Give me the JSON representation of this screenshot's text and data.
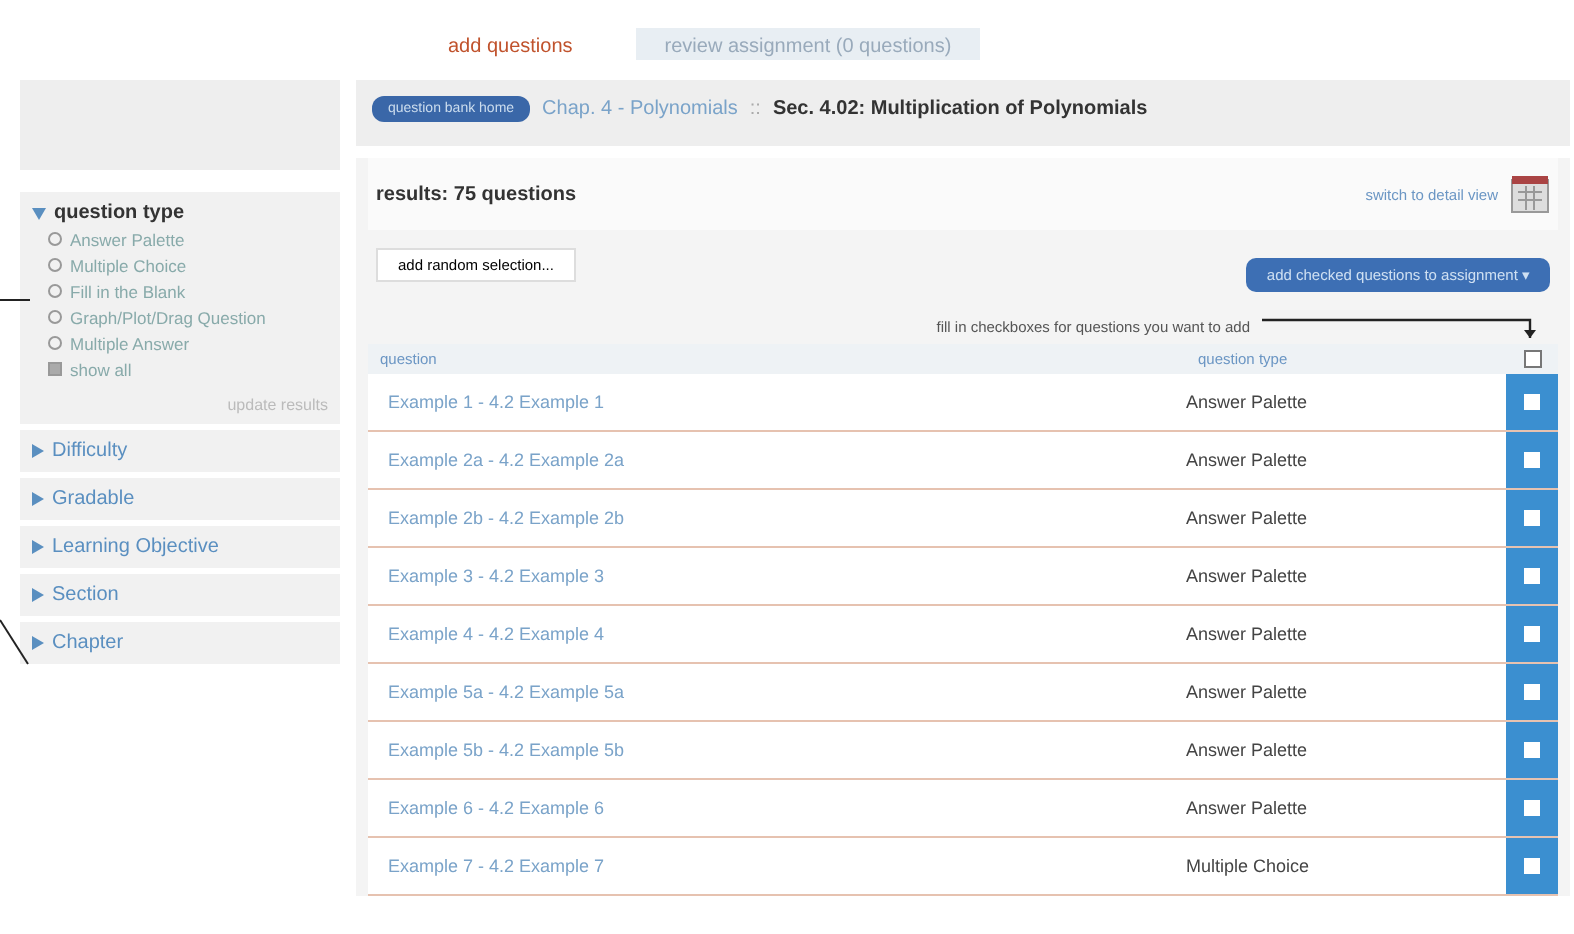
{
  "tabs": [
    {
      "label": "add questions",
      "selected": true
    },
    {
      "label": "review assignment (0 questions)",
      "selected": false
    }
  ],
  "sidebar": {
    "filters": [
      {
        "label": "question type",
        "expanded": true,
        "options": [
          {
            "label": "Answer Palette",
            "kind": "radio",
            "checked": false
          },
          {
            "label": "Multiple Choice",
            "kind": "radio",
            "checked": false
          },
          {
            "label": "Fill in the Blank",
            "kind": "radio",
            "checked": false
          },
          {
            "label": "Graph/Plot/Drag Question",
            "kind": "radio",
            "checked": false
          },
          {
            "label": "Multiple Answer",
            "kind": "radio",
            "checked": false
          },
          {
            "label": "show all",
            "kind": "check",
            "checked": true
          }
        ],
        "action": "update results"
      },
      {
        "label": "Difficulty",
        "expanded": false
      },
      {
        "label": "Gradable",
        "expanded": false
      },
      {
        "label": "Learning Objective",
        "expanded": false
      },
      {
        "label": "Section",
        "expanded": false
      },
      {
        "label": "Chapter",
        "expanded": false
      }
    ]
  },
  "breadcrumb": {
    "button": "question bank home",
    "chapter": "Chap. 4 - Polynomials",
    "separator": "::",
    "section": "Sec. 4.02: Multiplication of Polynomials"
  },
  "results": {
    "count": "results: 75 questions",
    "view_link": "switch to detail view",
    "random_button": "add random selection...",
    "add_button": "add checked questions to assignment ▾",
    "hint": "fill in checkboxes for questions you want to add",
    "columns": [
      "question",
      "question type"
    ],
    "select_all": false,
    "rows": [
      {
        "question": "Example 1 - 4.2 Example 1",
        "type": "Answer Palette",
        "checked": false
      },
      {
        "question": "Example 2a - 4.2 Example 2a",
        "type": "Answer Palette",
        "checked": false
      },
      {
        "question": "Example 2b - 4.2 Example 2b",
        "type": "Answer Palette",
        "checked": false
      },
      {
        "question": "Example 3 - 4.2 Example 3",
        "type": "Answer Palette",
        "checked": false
      },
      {
        "question": "Example 4 - 4.2 Example 4",
        "type": "Answer Palette",
        "checked": false
      },
      {
        "question": "Example 5a - 4.2 Example 5a",
        "type": "Answer Palette",
        "checked": false
      },
      {
        "question": "Example 5b - 4.2 Example 5b",
        "type": "Answer Palette",
        "checked": false
      },
      {
        "question": "Example 6 - 4.2 Example 6",
        "type": "Answer Palette",
        "checked": false
      },
      {
        "question": "Example 7 - 4.2 Example 7",
        "type": "Multiple Choice",
        "checked": false
      }
    ]
  }
}
